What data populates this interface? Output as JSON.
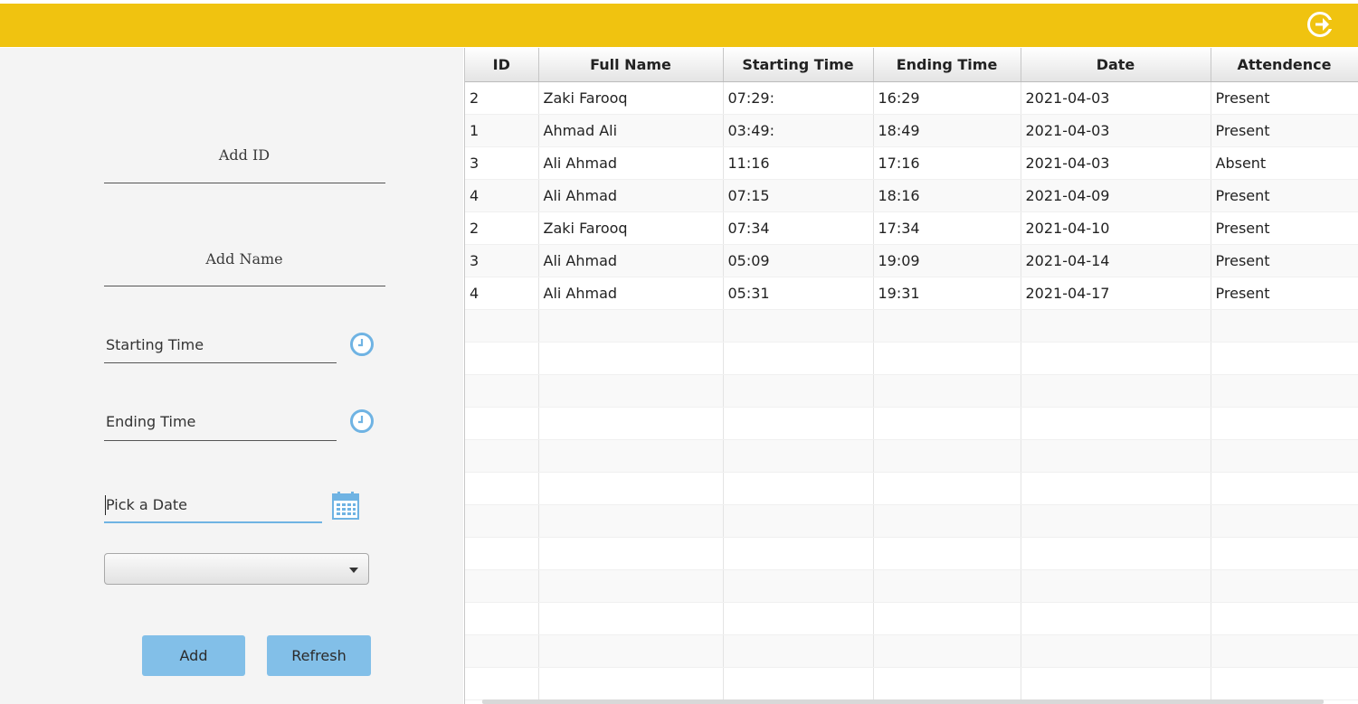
{
  "form": {
    "add_id_placeholder": "Add ID",
    "add_name_placeholder": "Add Name",
    "starting_time_placeholder": "Starting Time",
    "ending_time_placeholder": "Ending Time",
    "date_placeholder": "Pick a Date",
    "status_select_value": "",
    "add_button": "Add",
    "refresh_button": "Refresh"
  },
  "table": {
    "columns": [
      "ID",
      "Full Name",
      "Starting Time",
      "Ending Time",
      "Date",
      "Attendence"
    ],
    "rows": [
      [
        "2",
        "Zaki Farooq",
        "07:29:",
        "16:29",
        "2021-04-03",
        "Present"
      ],
      [
        "1",
        "Ahmad Ali",
        "03:49:",
        "18:49",
        "2021-04-03",
        "Present"
      ],
      [
        "3",
        "Ali Ahmad",
        "11:16",
        "17:16",
        "2021-04-03",
        "Absent"
      ],
      [
        "4",
        "Ali Ahmad",
        "07:15",
        "18:16",
        "2021-04-09",
        "Present"
      ],
      [
        "2",
        "Zaki Farooq",
        "07:34",
        "17:34",
        "2021-04-10",
        "Present"
      ],
      [
        "3",
        "Ali Ahmad",
        "05:09",
        "19:09",
        "2021-04-14",
        "Present"
      ],
      [
        "4",
        "Ali Ahmad",
        "05:31",
        "19:31",
        "2021-04-17",
        "Present"
      ]
    ]
  },
  "colors": {
    "topbar": "#f0c310",
    "accent": "#82bfe8",
    "icon": "#6fb3e3"
  },
  "icons": {
    "logout": "logout-icon",
    "clock": "clock-icon",
    "calendar": "calendar-icon"
  }
}
